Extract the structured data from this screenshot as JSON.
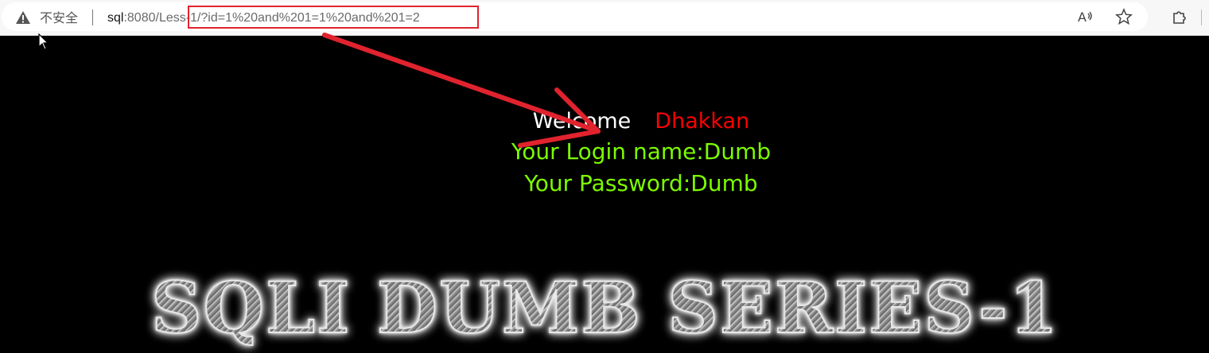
{
  "browser": {
    "security_label": "不安全",
    "url_host": "sql",
    "url_rest": ":8080/Less-1/?id=1%20and%201=1%20and%201=2",
    "icons": [
      "warning-icon",
      "read-aloud-icon",
      "favorite-star-icon",
      "extensions-icon"
    ]
  },
  "page": {
    "welcome": "Welcome",
    "name": "Dhakkan",
    "login_line": "Your Login name:Dumb",
    "password_line": "Your Password:Dumb",
    "banner": "SQLI DUMB SERIES-1"
  },
  "colors": {
    "background": "#000000",
    "result_text": "#7cfc00",
    "name_text": "#ff0000",
    "annotation": "#e0232e"
  }
}
